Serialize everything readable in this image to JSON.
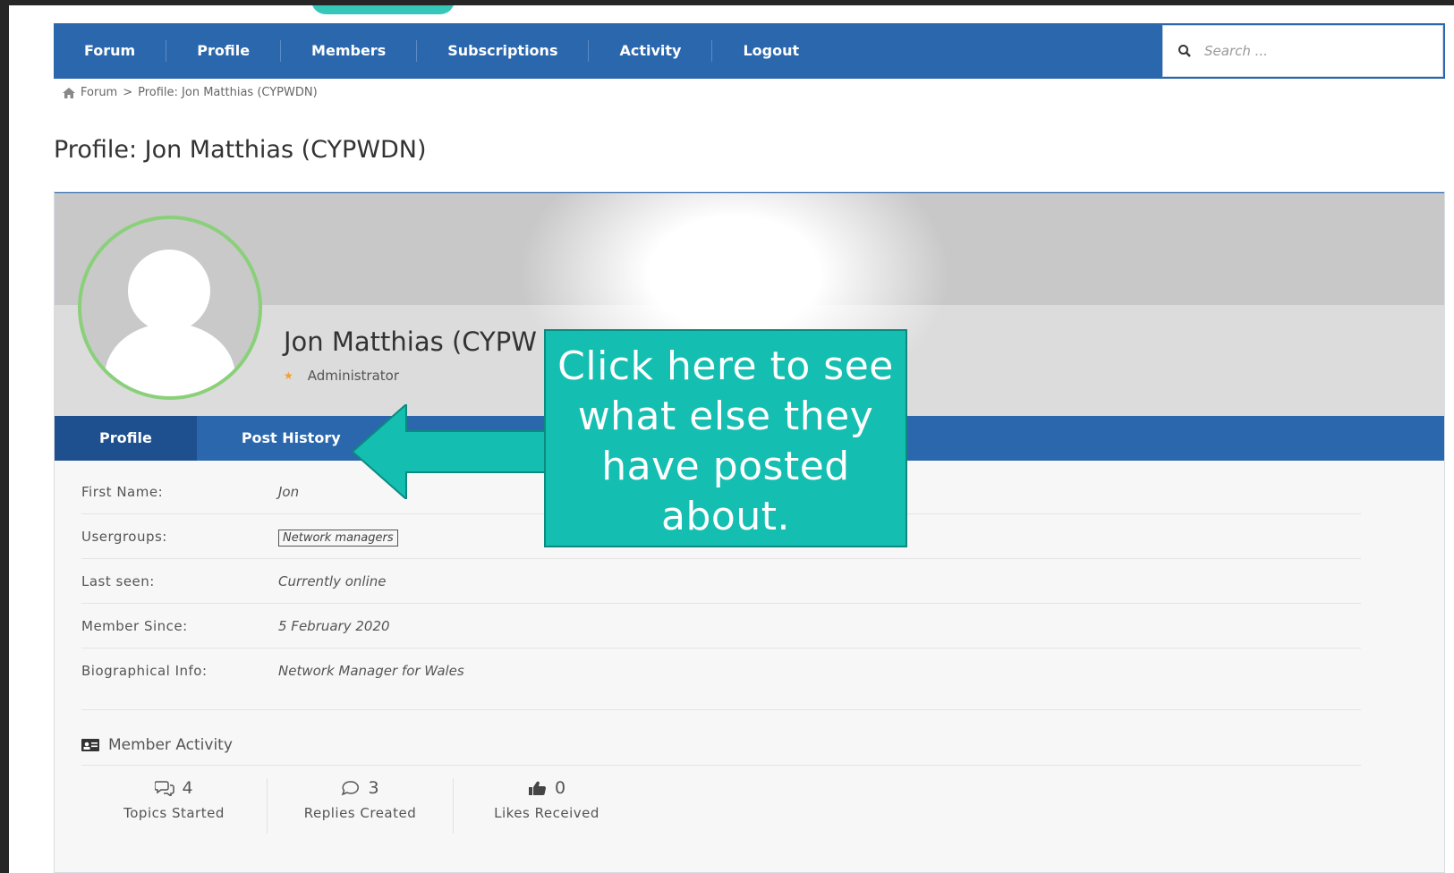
{
  "nav": {
    "items": [
      "Forum",
      "Profile",
      "Members",
      "Subscriptions",
      "Activity",
      "Logout"
    ],
    "search_placeholder": "Search ..."
  },
  "breadcrumb": {
    "home": "Forum",
    "separator": ">",
    "current": "Profile: Jon Matthias (CYPWDN)"
  },
  "page_title": "Profile: Jon Matthias (CYPWDN)",
  "profile": {
    "name": "Jon Matthias (CYPW",
    "role": "Administrator",
    "tabs": [
      "Profile",
      "Post History"
    ],
    "fields": [
      {
        "label": "First Name:",
        "value": "Jon"
      },
      {
        "label": "Usergroups:",
        "value": "Network managers"
      },
      {
        "label": "Last seen:",
        "value": "Currently online"
      },
      {
        "label": "Member Since:",
        "value": "5 February 2020"
      },
      {
        "label": "Biographical Info:",
        "value": "Network Manager for Wales"
      }
    ]
  },
  "activity": {
    "title": "Member Activity",
    "stats": [
      {
        "value": "4",
        "label": "Topics Started",
        "icon": "topics-icon"
      },
      {
        "value": "3",
        "label": "Replies Created",
        "icon": "reply-icon"
      },
      {
        "value": "0",
        "label": "Likes Received",
        "icon": "thumbs-up-icon"
      }
    ]
  },
  "callout": {
    "text": "Click here to see what else they have posted about."
  },
  "colors": {
    "nav_blue": "#2a67ad",
    "callout_teal": "#14bfb1",
    "avatar_ring": "#8ad07a"
  }
}
